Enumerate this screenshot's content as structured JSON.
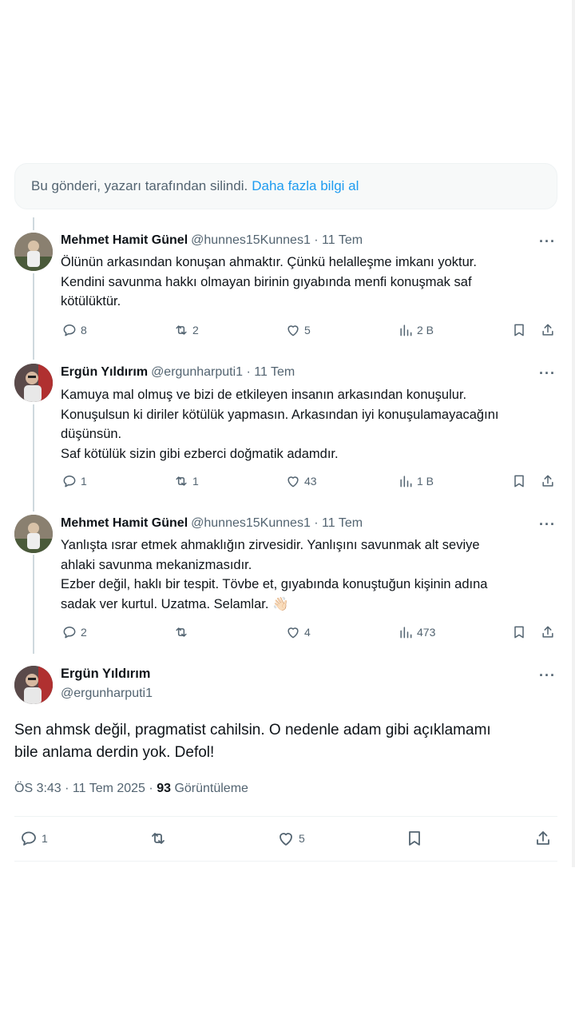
{
  "notice": {
    "text": "Bu gönderi, yazarı tarafından silindi.",
    "link": "Daha fazla bilgi al"
  },
  "tweets": [
    {
      "name": "Mehmet Hamit Günel",
      "meta": "@hunnes15Kunnes1 · 11 Tem",
      "lines": [
        "Ölünün arkasından konuşan ahmaktır. Çünkü helalleşme imkanı yoktur.",
        "Kendini savunma hakkı olmayan birinin gıyabında menfi konuşmak saf",
        "kötülüktür."
      ],
      "replies": "8",
      "reposts": "2",
      "likes": "5",
      "views": "2 B"
    },
    {
      "name": "Ergün Yıldırım",
      "meta": "@ergunharputi1 · 11 Tem",
      "lines": [
        "Kamuya mal olmuş ve bizi de etkileyen insanın arkasından konuşulur.",
        "Konuşulsun ki diriler kötülük yapmasın. Arkasından iyi konuşulamayacağını",
        "düşünsün.",
        "Saf kötülük sizin gibi ezberci doğmatik adamdır."
      ],
      "replies": "1",
      "reposts": "1",
      "likes": "43",
      "views": "1 B"
    },
    {
      "name": "Mehmet Hamit Günel",
      "meta": "@hunnes15Kunnes1 · 11 Tem",
      "lines": [
        "Yanlışta ısrar etmek ahmaklığın zirvesidir.  Yanlışını savunmak alt seviye",
        "ahlaki savunma mekanizmasıdır.",
        "Ezber değil, haklı bir tespit. Tövbe et, gıyabında konuştuğun kişinin adına",
        "sadak ver kurtul. Uzatma. Selamlar. 👋🏻"
      ],
      "replies": "2",
      "reposts": "",
      "likes": "4",
      "views": "473"
    }
  ],
  "main": {
    "name": "Ergün Yıldırım",
    "handle": "@ergunharputi1",
    "line1": "Sen ahmsk değil, pragmatist cahilsin. O nedenle adam gibi açıklamamı",
    "line2": "bile anlama derdin yok. Defol!",
    "time": "ÖS 3:43 · 11 Tem 2025 ·",
    "views_count": "93",
    "views_label": "Görüntüleme",
    "replies": "1",
    "likes": "5"
  },
  "more_label": "···",
  "colors": {
    "accent": "#1d9bf0",
    "muted": "#536471",
    "text": "#0f1419"
  }
}
